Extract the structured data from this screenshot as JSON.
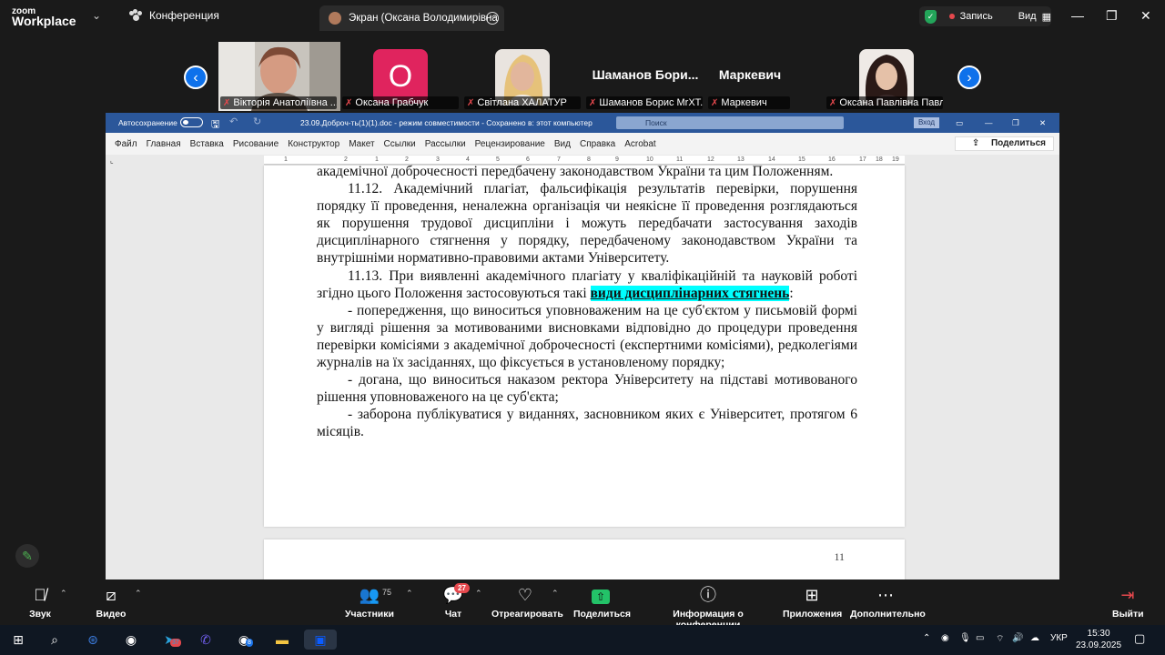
{
  "app": {
    "logo_line1": "zoom",
    "logo_line2": "Workplace",
    "meeting_label": "Конференция",
    "screen_tab": "Экран (Оксана Володимирівна",
    "record_label": "Запись",
    "view_label": "Вид"
  },
  "participants": [
    {
      "name": "Вікторія Анатоліївна ...",
      "kind": "photo",
      "muted": true
    },
    {
      "name": "Оксана Грабчук",
      "kind": "initial",
      "initial": "О",
      "muted": true
    },
    {
      "name": "Світлана ХАЛАТУР",
      "kind": "photo",
      "muted": true
    },
    {
      "name": "Шаманов Борис МrХТ...",
      "kind": "text",
      "display": "Шаманов Бори...",
      "muted": true
    },
    {
      "name": "Маркевич",
      "kind": "text",
      "display": "Маркевич",
      "muted": true
    },
    {
      "name": "Оксана Павлівна Павл...",
      "kind": "photo",
      "muted": true
    }
  ],
  "word": {
    "autosave": "Автосохранение",
    "filename": "23.09.Доброч-ть(1)(1).doc  -  режим совместимости  -  Сохранено в: этот компьютер",
    "search_placeholder": "Поиск",
    "signin": "Вход",
    "menu": [
      "Файл",
      "Главная",
      "Вставка",
      "Рисование",
      "Конструктор",
      "Макет",
      "Ссылки",
      "Рассылки",
      "Рецензирование",
      "Вид",
      "Справка",
      "Acrobat"
    ],
    "share": "Поделиться",
    "ruler": [
      "1",
      "2",
      "1",
      "2",
      "3",
      "4",
      "5",
      "6",
      "7",
      "8",
      "9",
      "10",
      "11",
      "12",
      "13",
      "14",
      "15",
      "16",
      "17",
      "18",
      "19"
    ],
    "page_number": "11"
  },
  "document": {
    "p0": "академічної доброчесності передбачену законодавством України та цим Положенням.",
    "p1": "11.12. Академічний плагіат, фальсифікація результатів перевірки, порушення порядку її проведення, неналежна організація чи неякісне її проведення розглядаються як порушення трудової дисципліни і можуть передбачати застосування заходів дисциплінарного стягнення у порядку, передбаченому законодавством України та внутрішніми нормативно-правовими актами Університету.",
    "p2_pre": "11.13. При виявленні академічного плагіату у кваліфікаційній та науковій роботі згідно цього Положення застосовуються такі ",
    "p2_hl": "види дисциплінарних стягнень",
    "p2_post": ":",
    "p3": "-    попередження, що виноситься уповноваженим на це суб'єктом у письмовій формі у вигляді рішення за мотивованими висновками відповідно до процедури проведення перевірки комісіями з академічної доброчесності (експертними комісіями), редколегіями журналів на їх засіданнях, що фіксується в установленому порядку;",
    "p4": "-    догана, що виноситься наказом ректора Університету на підставі мотивованого рішення уповноваженого на це суб'єкта;",
    "p5": "-    заборона публікуватися у виданнях, засновником яких є Університет, протягом 6 місяців."
  },
  "toolbar": {
    "audio": "Звук",
    "video": "Видео",
    "participants": "Участники",
    "participants_count": "75",
    "chat": "Чат",
    "chat_badge": "27",
    "react": "Отреагировать",
    "share": "Поделиться",
    "info": "Информация о конференции",
    "apps": "Приложения",
    "more": "Дополнительно",
    "leave": "Выйти"
  },
  "taskbar": {
    "lang": "УКР",
    "time": "15:30",
    "date": "23.09.2025",
    "telegram_badge": "37",
    "chrome_badge": "8"
  }
}
